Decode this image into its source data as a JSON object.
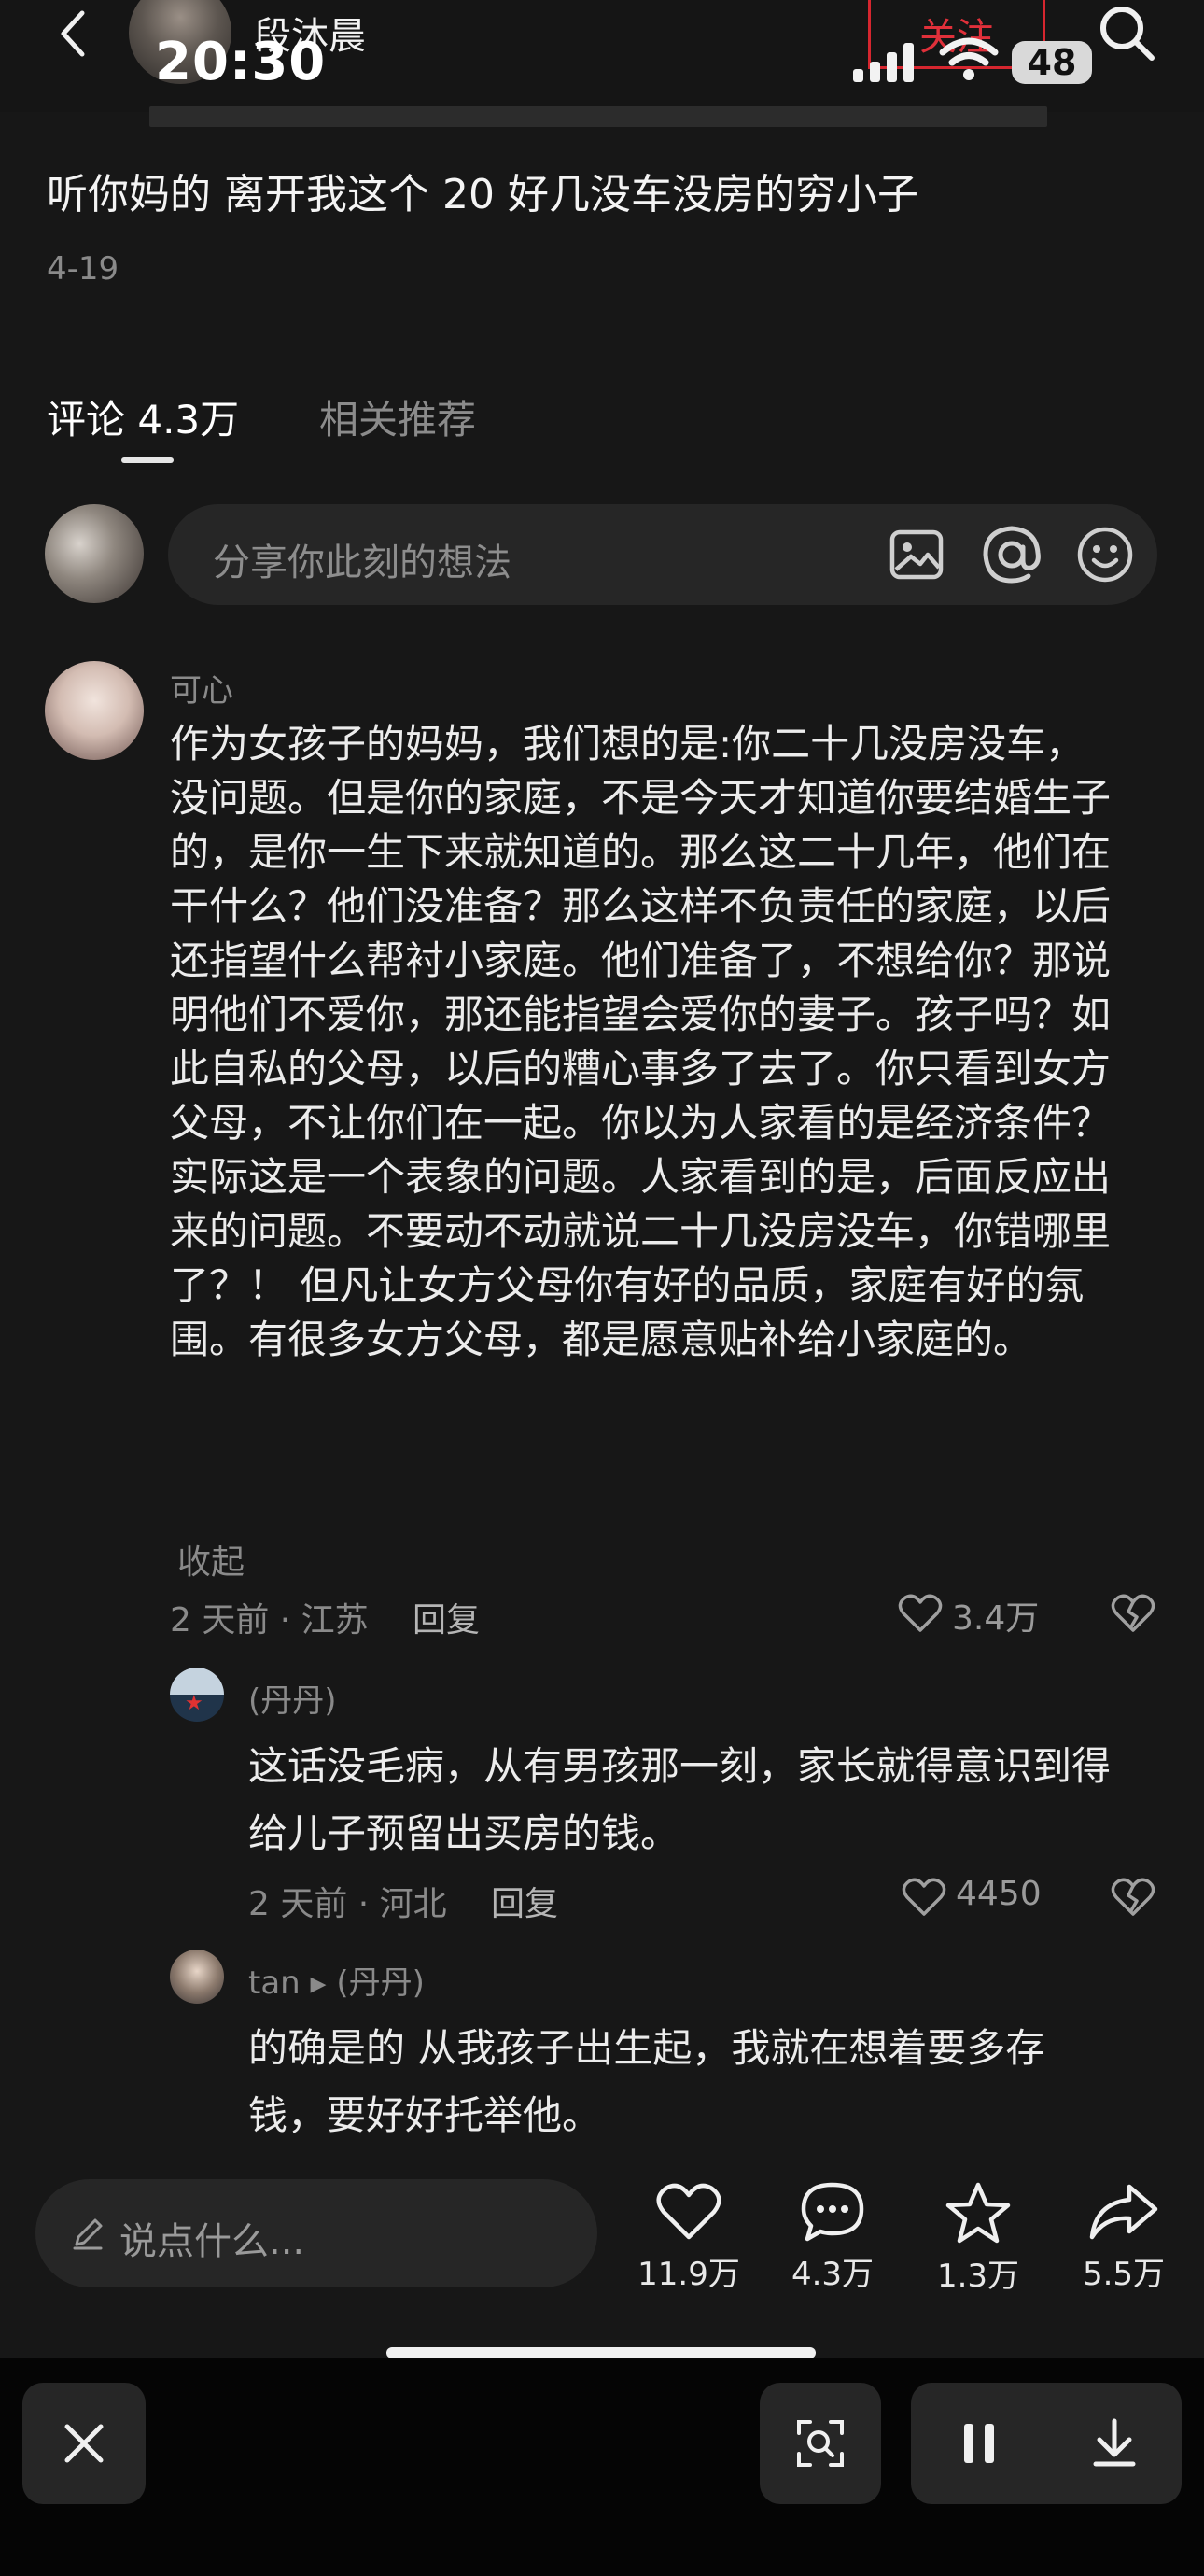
{
  "status_bar": {
    "time": "20:30",
    "battery": "48",
    "icons": [
      "signal-icon",
      "wifi-icon",
      "battery-icon"
    ]
  },
  "header": {
    "author_name": "段沐晨",
    "follow_label": "关注",
    "back_icon": "chevron-left-icon",
    "search_icon": "search-icon"
  },
  "post": {
    "title": "听你妈的 离开我这个 20 好几没车没房的穷小子",
    "date": "4-19"
  },
  "tabs": {
    "comments_label": "评论 4.3万",
    "related_label": "相关推荐"
  },
  "composer": {
    "placeholder": "分享你此刻的想法"
  },
  "comments": [
    {
      "name": "可心",
      "lines": [
        "作为女孩子的妈妈，我们想的是:你二十几没房没车，",
        "没问题。但是你的家庭，不是今天才知道你要结婚生子",
        "的，是你一生下来就知道的。那么这二十几年，他们在",
        "干什么？他们没准备？那么这样不负责任的家庭，以后",
        "还指望什么帮衬小家庭。他们准备了，不想给你？那说",
        "明他们不爱你，那还能指望会爱你的妻子。孩子吗？如",
        "此自私的父母，以后的糟心事多了去了。你只看到女方",
        "父母，不让你们在一起。你以为人家看的是经济条件？",
        "实际这是一个表象的问题。人家看到的是，后面反应出",
        "来的问题。不要动不动就说二十几没房没车，你错哪里",
        "了？！ 但凡让女方父母你有好的品质，家庭有好的氛",
        "围。有很多女方父母，都是愿意贴补给小家庭的。"
      ],
      "collapse_label": "收起",
      "meta": "2 天前 · 江苏",
      "reply_label": "回复",
      "likes": "3.4万"
    }
  ],
  "replies": [
    {
      "name": "(丹丹)",
      "lines": [
        "这话没毛病，从有男孩那一刻，家长就得意识到得",
        "给儿子预留出买房的钱。"
      ],
      "meta": "2 天前 · 河北",
      "reply_label": "回复",
      "likes": "4450"
    },
    {
      "name": "tan ▸ (丹丹)",
      "lines": [
        "的确是的 从我孩子出生起，我就在想着要多存",
        "钱，要好好托举他。"
      ]
    }
  ],
  "bottom_bar": {
    "placeholder": "说点什么...",
    "like_count": "11.9万",
    "comment_count": "4.3万",
    "star_count": "1.3万",
    "share_count": "5.5万"
  },
  "colors": {
    "background": "#171717",
    "follow_red": "#e0303a",
    "text_primary": "#ececec",
    "text_secondary": "#8a8a8a"
  }
}
